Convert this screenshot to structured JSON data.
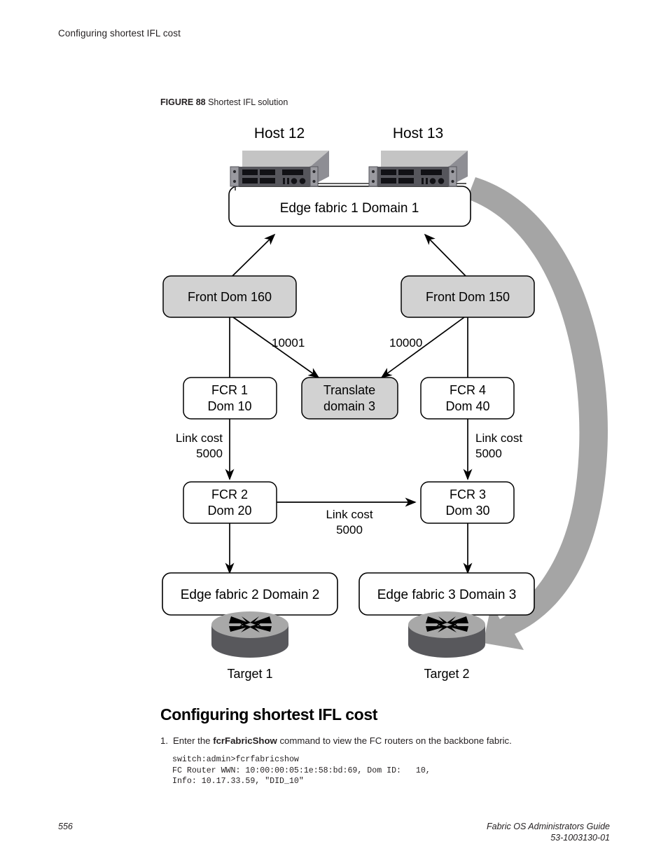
{
  "header": {
    "running_title": "Configuring shortest IFL cost"
  },
  "figure": {
    "number_label": "FIGURE 88",
    "title": "Shortest IFL solution"
  },
  "diagram": {
    "hosts": [
      {
        "label": "Host 12"
      },
      {
        "label": "Host 13"
      }
    ],
    "edge_fabric_top": "Edge fabric 1 Domain 1",
    "front_domains": [
      {
        "label": "Front Dom 160"
      },
      {
        "label": "Front Dom 150"
      }
    ],
    "front_dom_costs": [
      {
        "value": "10001"
      },
      {
        "value": "10000"
      }
    ],
    "translate_domain": {
      "line1": "Translate",
      "line2": "domain 3"
    },
    "fcr_nodes": [
      {
        "line1": "FCR 1",
        "line2": "Dom 10"
      },
      {
        "line1": "FCR 4",
        "line2": "Dom 40"
      },
      {
        "line1": "FCR 2",
        "line2": "Dom 20"
      },
      {
        "line1": "FCR 3",
        "line2": "Dom 30"
      }
    ],
    "link_costs": [
      {
        "line1": "Link cost",
        "line2": "5000"
      },
      {
        "line1": "Link cost",
        "line2": "5000"
      },
      {
        "line1": "Link cost",
        "line2": "5000"
      }
    ],
    "edge_fabrics_bottom": [
      {
        "label": "Edge fabric 2 Domain 2"
      },
      {
        "label": "Edge fabric 3 Domain 3"
      }
    ],
    "targets": [
      {
        "label": "Target 1"
      },
      {
        "label": "Target 2"
      }
    ],
    "colors": {
      "shaded_box_fill": "#d2d2d2",
      "white_box_fill": "#ffffff",
      "box_stroke": "#000000",
      "switch_top": "#c4c4c4",
      "switch_front": "#56565c",
      "switch_side": "#8e8e94",
      "router_top": "#a8a8a8",
      "router_body": "#58585c",
      "flow_arrow": "#a5a5a5"
    }
  },
  "section": {
    "heading": "Configuring shortest IFL cost"
  },
  "step": {
    "number": "1.",
    "text_before": "Enter the ",
    "command": "fcrFabricShow",
    "text_after": " command to view the FC routers on the backbone fabric."
  },
  "code": {
    "lines": "switch:admin>fcrfabricshow\nFC Router WWN: 10:00:00:05:1e:58:bd:69, Dom ID:   10,\nInfo: 10.17.33.59, \"DID_10\""
  },
  "footer": {
    "page_number": "556",
    "guide_title": "Fabric OS Administrators Guide",
    "document_number": "53-1003130-01"
  }
}
